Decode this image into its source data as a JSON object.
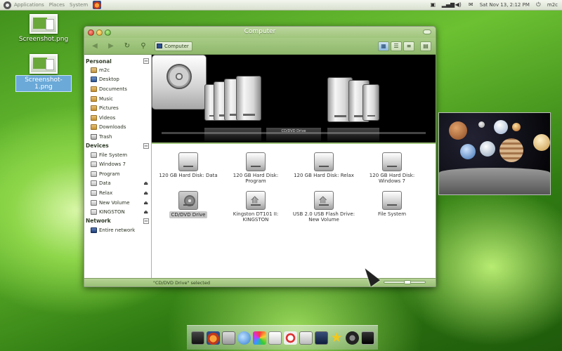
{
  "top_panel": {
    "menus": [
      "Applications",
      "Places",
      "System"
    ],
    "clock": "Sat Nov 13,  2:12 PM",
    "user": "m2c"
  },
  "desktop_icons": [
    {
      "label": "Screenshot.png",
      "selected": false
    },
    {
      "label": "Screenshot-1.png",
      "selected": true
    }
  ],
  "window": {
    "title": "Computer",
    "location": "Computer",
    "sidebar": {
      "sections": [
        {
          "title": "Personal",
          "items": [
            {
              "label": "m2c",
              "icon": "home-icon"
            },
            {
              "label": "Desktop",
              "icon": "desktop-icon"
            },
            {
              "label": "Documents",
              "icon": "folder-icon"
            },
            {
              "label": "Music",
              "icon": "folder-icon"
            },
            {
              "label": "Pictures",
              "icon": "folder-icon"
            },
            {
              "label": "Videos",
              "icon": "folder-icon"
            },
            {
              "label": "Downloads",
              "icon": "folder-icon"
            },
            {
              "label": "Trash",
              "icon": "trash-icon"
            }
          ]
        },
        {
          "title": "Devices",
          "items": [
            {
              "label": "File System",
              "icon": "drive-icon",
              "eject": false
            },
            {
              "label": "Windows 7",
              "icon": "drive-icon",
              "eject": false
            },
            {
              "label": "Program",
              "icon": "drive-icon",
              "eject": false
            },
            {
              "label": "Data",
              "icon": "drive-icon",
              "eject": true
            },
            {
              "label": "Relax",
              "icon": "drive-icon",
              "eject": true
            },
            {
              "label": "New Volume",
              "icon": "drive-icon",
              "eject": true
            },
            {
              "label": "KINGSTON",
              "icon": "drive-icon",
              "eject": true
            }
          ]
        },
        {
          "title": "Network",
          "items": [
            {
              "label": "Entire network",
              "icon": "network-icon"
            }
          ]
        }
      ]
    },
    "banner_label": "CD/DVD Drive",
    "items": [
      {
        "label": "120 GB Hard Disk: Data",
        "icon": "hard-disk-icon",
        "selected": false
      },
      {
        "label": "120 GB Hard Disk: Program",
        "icon": "hard-disk-icon",
        "selected": false
      },
      {
        "label": "120 GB Hard Disk: Relax",
        "icon": "hard-disk-icon",
        "selected": false
      },
      {
        "label": "120 GB Hard Disk: Windows 7",
        "icon": "hard-disk-icon",
        "selected": false
      },
      {
        "label": "CD/DVD Drive",
        "icon": "dvd-drive-icon",
        "selected": true
      },
      {
        "label": "Kingston DT101 II: KINGSTON",
        "icon": "usb-drive-icon",
        "selected": false
      },
      {
        "label": "USB 2.0 USB Flash Drive: New Volume",
        "icon": "usb-drive-icon",
        "selected": false
      },
      {
        "label": "File System",
        "icon": "hard-disk-icon",
        "selected": false
      }
    ],
    "status": "\"CD/DVD Drive\" selected"
  },
  "dock": {
    "items": [
      "terminal-icon",
      "firefox-icon",
      "calculator-icon",
      "chat-icon",
      "image-viewer-icon",
      "text-editor-icon",
      "debian-icon",
      "document-icon",
      "monitor-icon",
      "star-icon",
      "camera-icon",
      "screenshot-icon"
    ]
  }
}
